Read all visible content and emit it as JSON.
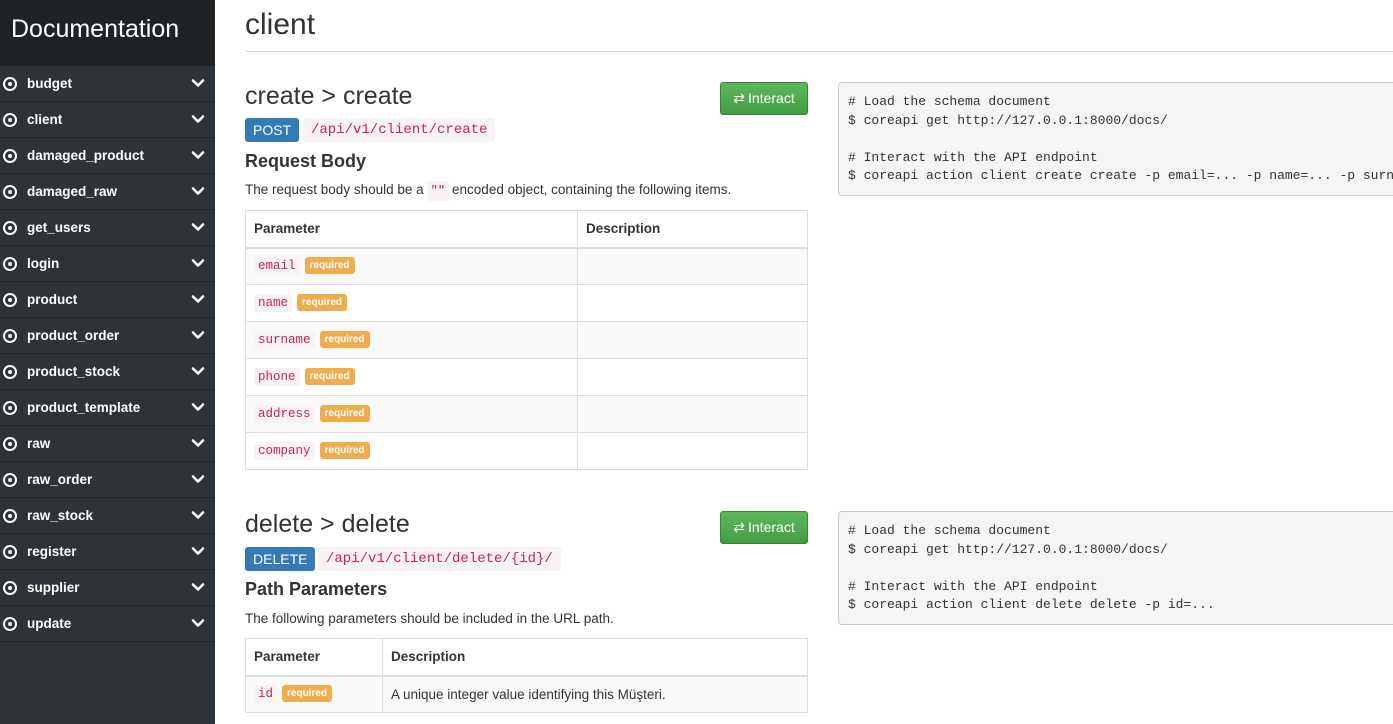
{
  "sidebar": {
    "title": "Documentation",
    "items": [
      {
        "label": "budget"
      },
      {
        "label": "client"
      },
      {
        "label": "damaged_product"
      },
      {
        "label": "damaged_raw"
      },
      {
        "label": "get_users"
      },
      {
        "label": "login"
      },
      {
        "label": "product"
      },
      {
        "label": "product_order"
      },
      {
        "label": "product_stock"
      },
      {
        "label": "product_template"
      },
      {
        "label": "raw"
      },
      {
        "label": "raw_order"
      },
      {
        "label": "raw_stock"
      },
      {
        "label": "register"
      },
      {
        "label": "supplier"
      },
      {
        "label": "update"
      }
    ],
    "chevron": "chevron-down-icon",
    "item_icon": "radio-dot-icon"
  },
  "page": {
    "title": "client"
  },
  "endpoints": [
    {
      "title": "create > create",
      "interact_label": "Interact",
      "method": "POST",
      "path": "/api/v1/client/create",
      "section_heading": "Request Body",
      "desc_before": "The request body should be a",
      "desc_code": "\"\"",
      "desc_after": "encoded object, containing the following items.",
      "table": {
        "headers": [
          "Parameter",
          "Description"
        ],
        "rows": [
          {
            "name": "email",
            "badge": "required",
            "description": ""
          },
          {
            "name": "name",
            "badge": "required",
            "description": ""
          },
          {
            "name": "surname",
            "badge": "required",
            "description": ""
          },
          {
            "name": "phone",
            "badge": "required",
            "description": ""
          },
          {
            "name": "address",
            "badge": "required",
            "description": ""
          },
          {
            "name": "company",
            "badge": "required",
            "description": ""
          }
        ]
      },
      "code_lines": [
        "# Load the schema document",
        "$ coreapi get http://127.0.0.1:8000/docs/",
        "",
        "# Interact with the API endpoint",
        "$ coreapi action client create create -p email=... -p name=... -p surname=..."
      ]
    },
    {
      "title": "delete > delete",
      "interact_label": "Interact",
      "method": "DELETE",
      "path": "/api/v1/client/delete/{id}/",
      "section_heading": "Path Parameters",
      "desc": "The following parameters should be included in the URL path.",
      "table": {
        "headers": [
          "Parameter",
          "Description"
        ],
        "rows": [
          {
            "name": "id",
            "badge": "required",
            "description": "A unique integer value identifying this Müşteri."
          }
        ]
      },
      "code_lines": [
        "# Load the schema document",
        "$ coreapi get http://127.0.0.1:8000/docs/",
        "",
        "# Interact with the API endpoint",
        "$ coreapi action client delete delete -p id=..."
      ]
    }
  ],
  "colors": {
    "sidebar_bg": "#2e3338",
    "sidebar_header_bg": "#1f2326",
    "interact_green": "#5cb85c",
    "method_blue": "#337ab7",
    "required_orange": "#f0ad4e",
    "code_red": "#c7254e"
  }
}
